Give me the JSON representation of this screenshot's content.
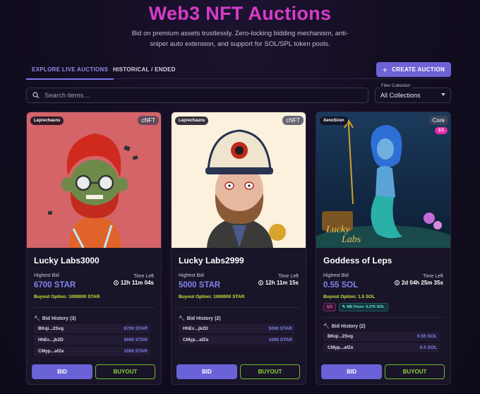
{
  "header": {
    "title": "Web3 NFT Auctions",
    "subtitle": "Bid on premium assets trustlessly. Zero-locking bidding mechanism, anti-sniper auto extension, and support for SOL/SPL token pools."
  },
  "tabs": [
    {
      "label": "EXPLORE LIVE AUCTIONS",
      "active": true
    },
    {
      "label": "HISTORICAL / ENDED",
      "active": false
    }
  ],
  "create_button": {
    "label": "CREATE AUCTION",
    "icon": "plus-icon"
  },
  "search": {
    "placeholder": "Search items...",
    "value": ""
  },
  "filter": {
    "label": "Filter Collection",
    "value": "All Collections"
  },
  "colors": {
    "title": "#d63cc9",
    "accent": "#6e63d6",
    "bid_value": "#7f86f2",
    "buyout": "#c5e53a",
    "buyout_border": "#6fb92b"
  },
  "cards": [
    {
      "collection": "Leprechauns",
      "type": "cNFT",
      "name": "Lucky Labs3000",
      "highest_bid_label": "Highest Bid",
      "highest_bid": "6700 STAR",
      "time_left_label": "Time Left",
      "time_left": "12h 11m 04s",
      "buyout_option": "Buyout Option: 1000000 STAR",
      "bid_history_title": "Bid History (3)",
      "bids": [
        {
          "addr": "BKqi...2Svg",
          "amount": "6700 STAR"
        },
        {
          "addr": "HhEc...jk2D",
          "amount": "5000 STAR"
        },
        {
          "addr": "CMyp...afZe",
          "amount": "1000 STAR"
        }
      ],
      "bid_label": "BID",
      "buyout_label": "BUYOUT"
    },
    {
      "collection": "Leprechauns",
      "type": "cNFT",
      "name": "Lucky Labs2999",
      "highest_bid_label": "Highest Bid",
      "highest_bid": "5000 STAR",
      "time_left_label": "Time Left",
      "time_left": "12h 11m 15s",
      "buyout_option": "Buyout Option: 1000000 STAR",
      "bid_history_title": "Bid History (2)",
      "bids": [
        {
          "addr": "HhEc...jk2D",
          "amount": "5000 STAR"
        },
        {
          "addr": "CMyp...afZe",
          "amount": "1000 STAR"
        }
      ],
      "bid_label": "BID",
      "buyout_label": "BUYOUT"
    },
    {
      "collection": "XenoSiren",
      "type": "Core",
      "edition_badge": "1/1",
      "name": "Goddess of Leps",
      "highest_bid_label": "Highest Bid",
      "highest_bid": "0.55 SOL",
      "time_left_label": "Time Left",
      "time_left": "2d 04h 25m 35s",
      "buyout_option": "Buyout Option: 1.5 SOL",
      "mini_badges": [
        "1/1",
        "ME Floor: 0.275 SOL"
      ],
      "bid_history_title": "Bid History (2)",
      "bids": [
        {
          "addr": "BKqi...2Svg",
          "amount": "0.55 SOL"
        },
        {
          "addr": "CMyp...afZe",
          "amount": "0.5 SOL"
        }
      ],
      "bid_label": "BID",
      "buyout_label": "BUYOUT"
    }
  ]
}
